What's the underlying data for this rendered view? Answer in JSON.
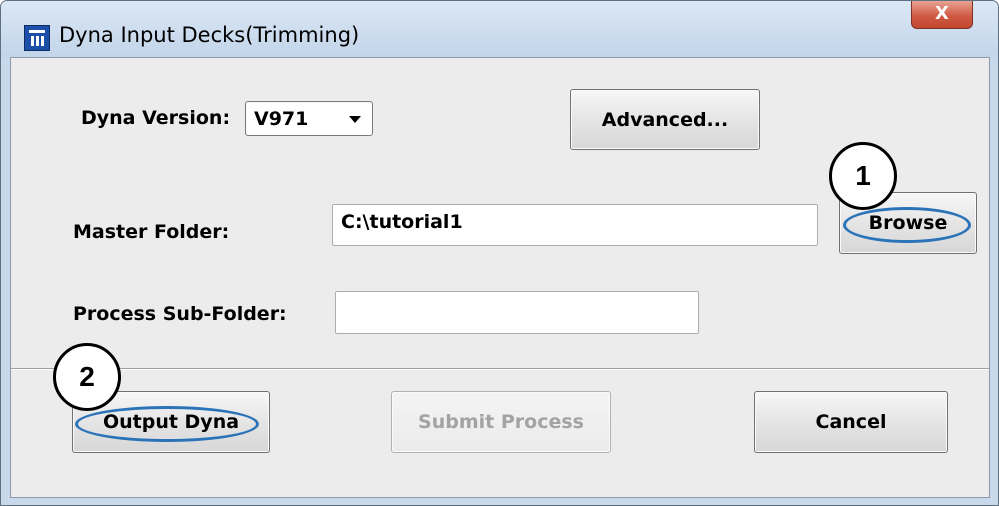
{
  "window": {
    "title": "Dyna Input Decks(Trimming)",
    "app_icon": "app-logo-icon",
    "close_glyph": "X"
  },
  "form": {
    "dyna_version_label": "Dyna Version:",
    "dyna_version_value": "V971",
    "advanced_label": "Advanced...",
    "master_folder_label": "Master Folder:",
    "master_folder_value": "C:\\tutorial1",
    "browse_label": "Browse",
    "process_subfolder_label": "Process Sub-Folder:",
    "process_subfolder_value": ""
  },
  "actions": {
    "output_dyna_label": "Output Dyna",
    "submit_process_label": "Submit Process",
    "cancel_label": "Cancel"
  },
  "annotations": {
    "step1": "1",
    "step2": "2",
    "highlight_color": "#2a73b8"
  }
}
